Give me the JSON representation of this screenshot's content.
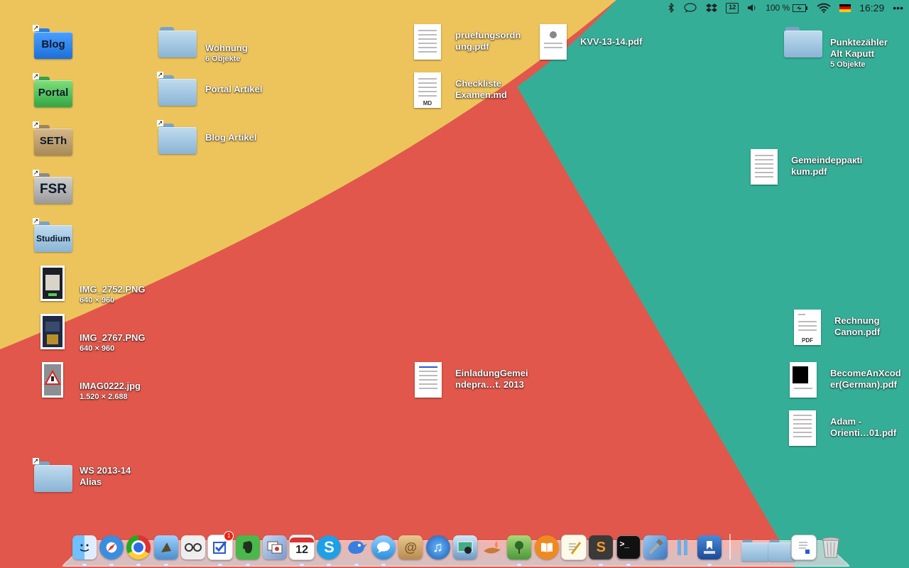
{
  "menubar": {
    "battery_text": "100 %",
    "calendar_day": "12",
    "clock": "16:29",
    "overflow": "•••"
  },
  "colors": {
    "yellow": "#edc45c",
    "red": "#e2574b",
    "teal": "#35ae98",
    "folder_blue": "#a8c8e0"
  },
  "desktop": {
    "blog": {
      "label": "Blog"
    },
    "portal": {
      "label": "Portal"
    },
    "seth": {
      "label": "SETh"
    },
    "fsr": {
      "label": "FSR"
    },
    "studium": {
      "label": "Studium"
    },
    "wohnung": {
      "name": "Wohnung",
      "meta": "6 Objekte"
    },
    "portal_artikel": {
      "name": "Portal Artikel"
    },
    "blog_artikel": {
      "name": "Blog Artikel"
    },
    "img2752": {
      "name": "IMG_2752.PNG",
      "meta": "640 × 960"
    },
    "img2767": {
      "name": "IMG_2767.PNG",
      "meta": "640 × 960"
    },
    "imag0222": {
      "name": "IMAG0222.jpg",
      "meta": "1.520 × 2.688"
    },
    "ws": {
      "name": "WS 2013-14\nAlias"
    },
    "pruefung": {
      "name": "pruefungsordn\nung.pdf"
    },
    "checkliste": {
      "name": "Checkliste\nExamen.md",
      "tag": "MD"
    },
    "kvv": {
      "name": "KVV-13-14.pdf"
    },
    "einladung": {
      "name": "EinladungGemei\nndepra…t. 2013"
    },
    "punkte": {
      "name": "Punktezähler\nAlt Kaputt",
      "meta": "5 Objekte"
    },
    "gemeinde": {
      "name": "Gemeindepракti\nkum.pdf"
    },
    "rechnung": {
      "name": "Rechnung\nCanon.pdf",
      "tag": "PDF"
    },
    "become": {
      "name": "BecomeAnXcod\ner(German).pdf"
    },
    "adam": {
      "name": "Adam -\nOrienti…01.pdf"
    }
  },
  "dock": {
    "calendar_day": "12",
    "reminders_badge": "1"
  }
}
